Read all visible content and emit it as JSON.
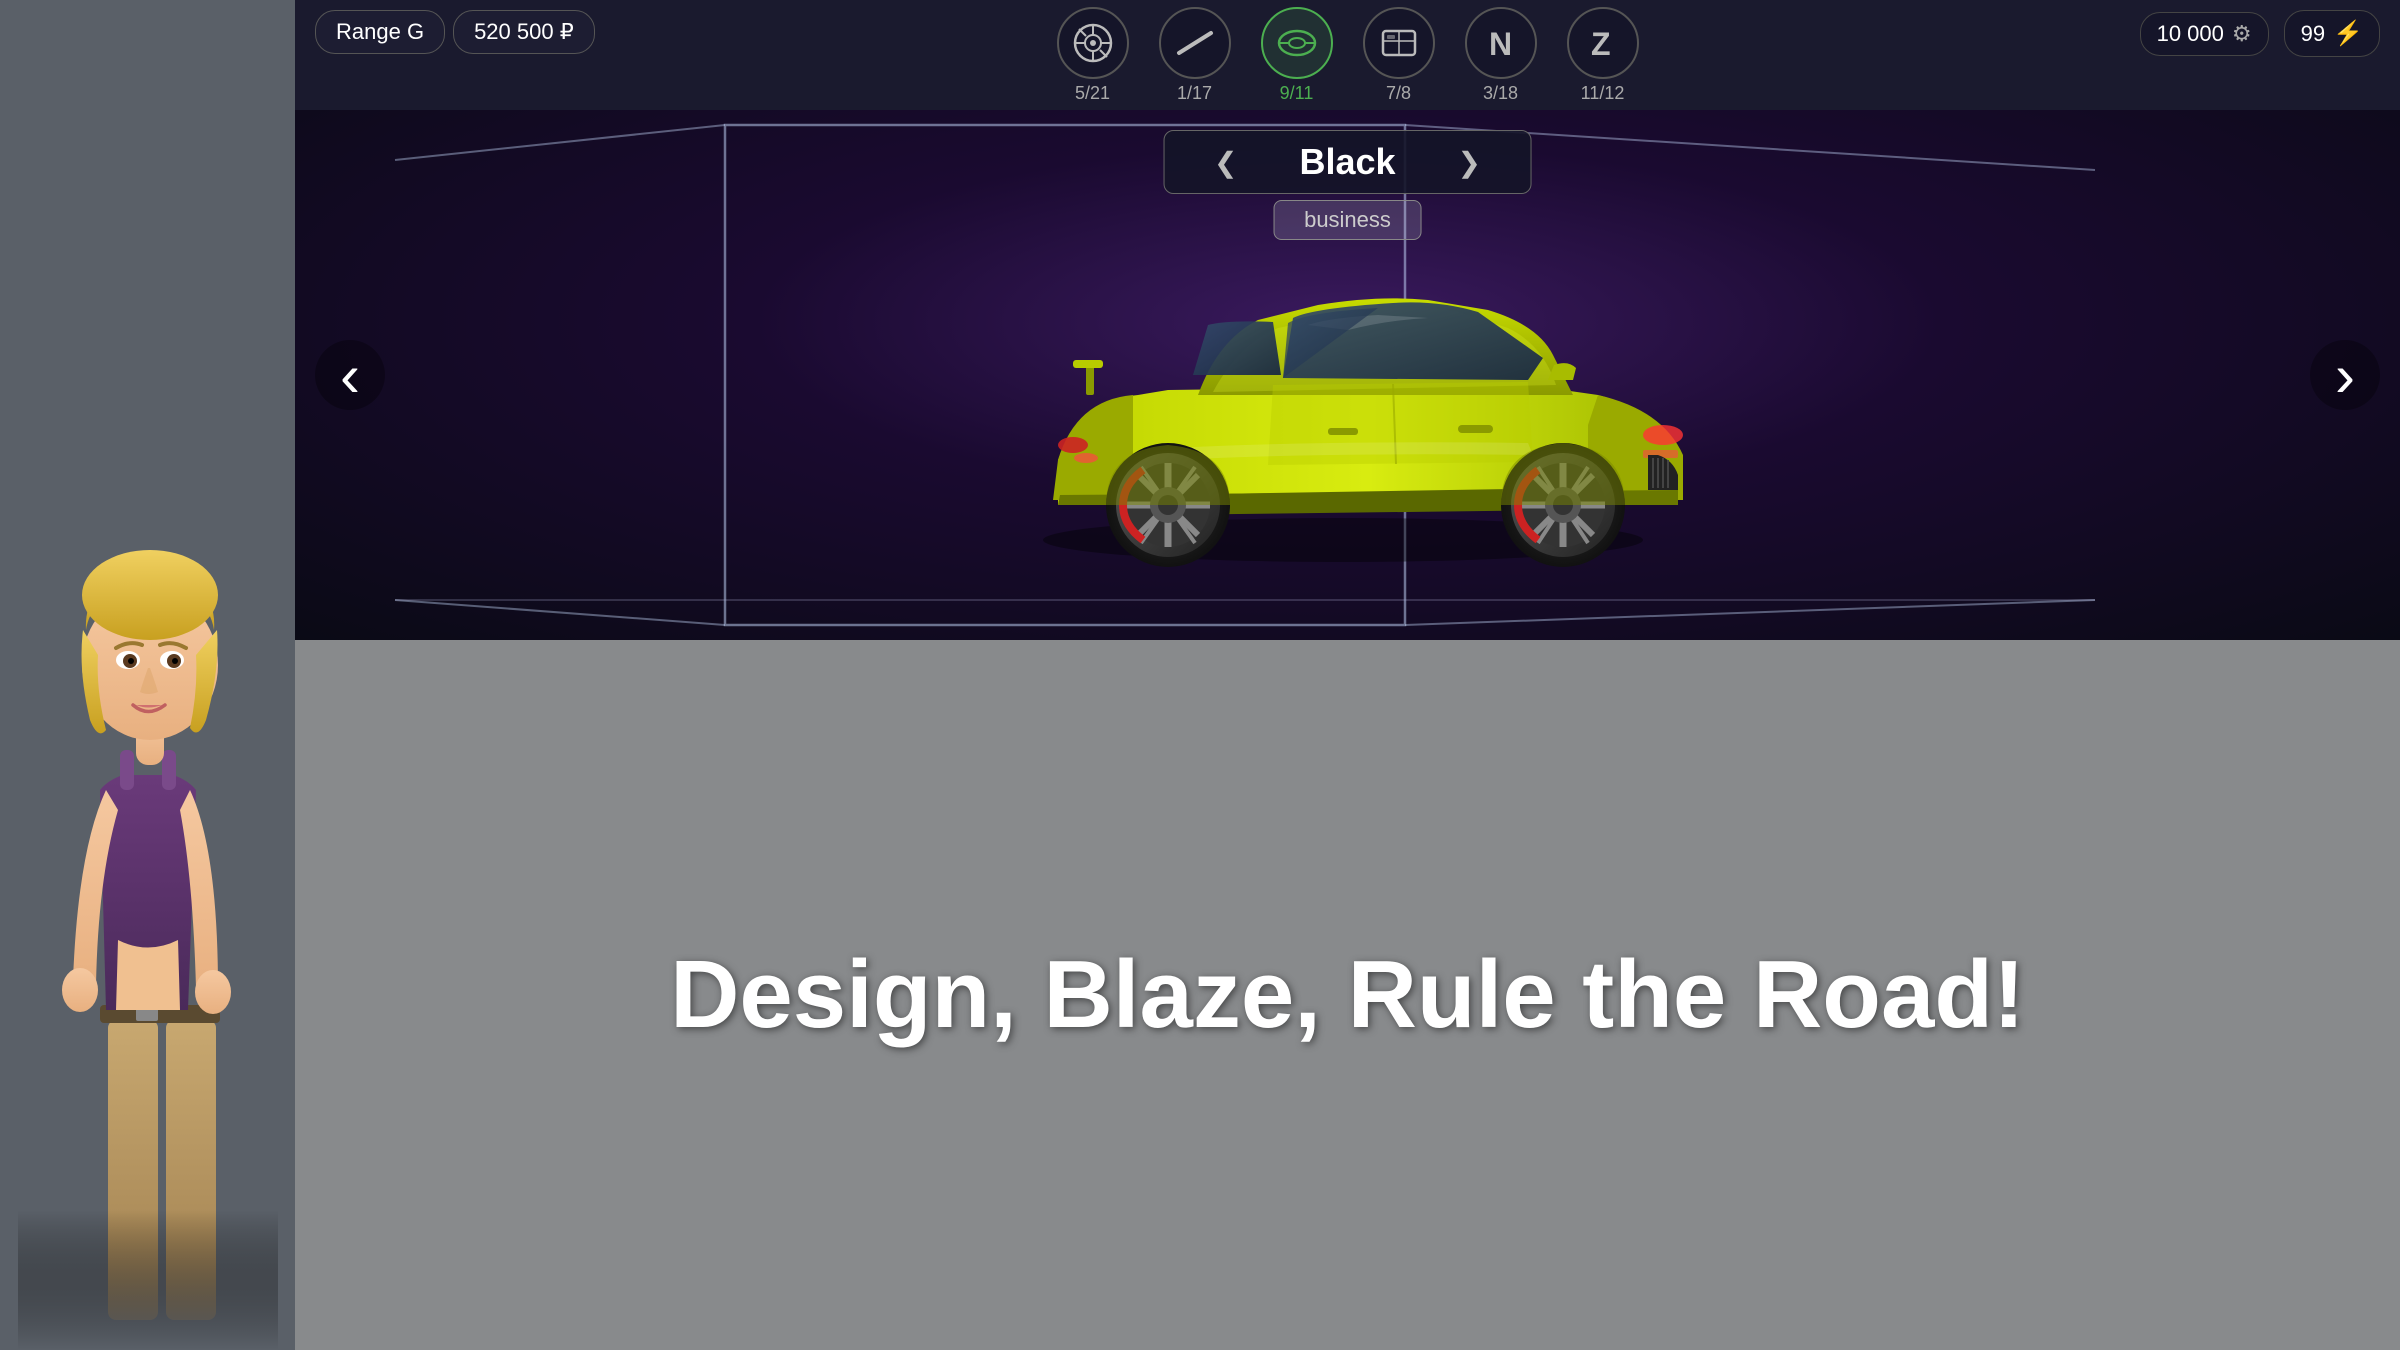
{
  "badges": {
    "range": "Range G",
    "price": "520 500 ₽"
  },
  "currency": {
    "coins": "10 000",
    "gems": "99"
  },
  "tabs": [
    {
      "icon": "wheel",
      "label": "5/21",
      "unicode": "◎",
      "active": false
    },
    {
      "icon": "stripe",
      "label": "1/17",
      "unicode": "⟋",
      "active": false
    },
    {
      "icon": "hood",
      "label": "9/11",
      "unicode": "⌀",
      "active": true
    },
    {
      "icon": "body",
      "label": "7/8",
      "unicode": "▣",
      "active": false
    },
    {
      "icon": "n-letter",
      "label": "3/18",
      "unicode": "N",
      "active": false
    },
    {
      "icon": "z-letter",
      "label": "11/12",
      "unicode": "Z",
      "active": false
    }
  ],
  "color_selector": {
    "name": "Black",
    "type": "business",
    "left_arrow": "❮",
    "right_arrow": "❯"
  },
  "navigation": {
    "left_arrow": "‹",
    "right_arrow": "›"
  },
  "tagline": "Design, Blaze, Rule the Road!"
}
